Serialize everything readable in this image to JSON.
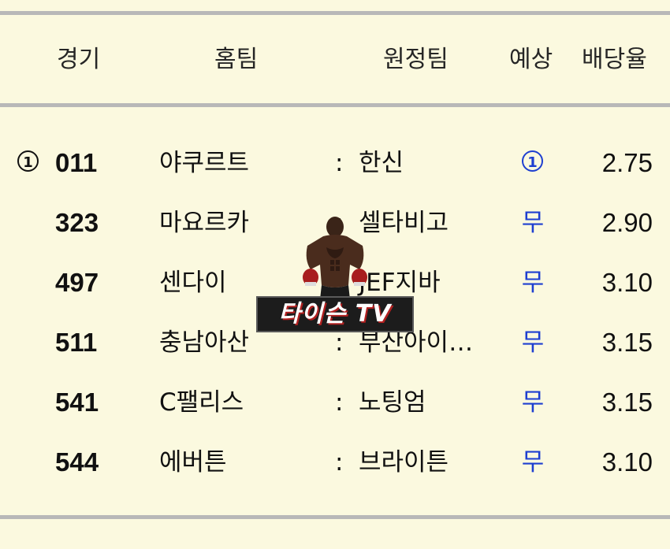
{
  "header": {
    "game": "경기",
    "home": "홈팀",
    "away": "원정팀",
    "prediction": "예상",
    "odds": "배당율"
  },
  "separator": ":",
  "rows": [
    {
      "mark": "1",
      "game": "011",
      "home": "야쿠르트",
      "away": "한신",
      "prediction": "1",
      "prediction_circled": true,
      "odds": "2.75"
    },
    {
      "mark": "",
      "game": "323",
      "home": "마요르카",
      "away": "셀타비고",
      "prediction": "무",
      "prediction_circled": false,
      "odds": "2.90"
    },
    {
      "mark": "",
      "game": "497",
      "home": "센다이",
      "away": "JEF지바",
      "prediction": "무",
      "prediction_circled": false,
      "odds": "3.10"
    },
    {
      "mark": "",
      "game": "511",
      "home": "충남아산",
      "away": "부산아이…",
      "prediction": "무",
      "prediction_circled": false,
      "odds": "3.15"
    },
    {
      "mark": "",
      "game": "541",
      "home": "C팰리스",
      "away": "노팅엄",
      "prediction": "무",
      "prediction_circled": false,
      "odds": "3.15"
    },
    {
      "mark": "",
      "game": "544",
      "home": "에버튼",
      "away": "브라이튼",
      "prediction": "무",
      "prediction_circled": false,
      "odds": "3.10"
    }
  ],
  "watermark": {
    "text": "타이슨 TV",
    "icon": "boxer-icon"
  },
  "colors": {
    "background": "#fbf9df",
    "rule": "#b8b8b8",
    "prediction": "#1e3fd0"
  }
}
